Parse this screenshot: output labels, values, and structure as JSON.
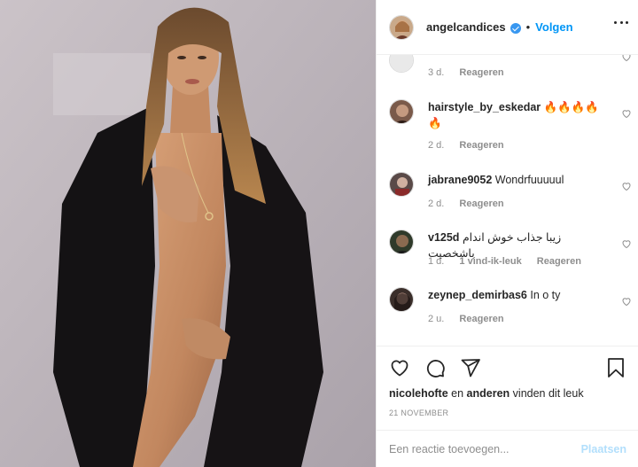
{
  "header": {
    "username": "angelcandices",
    "separator": "•",
    "follow_label": "Volgen"
  },
  "comments": [
    {
      "user": "",
      "text": "",
      "time": "3 d.",
      "likes": "",
      "reply_label": "Reageren"
    },
    {
      "user": "hairstyle_by_eskedar",
      "text": "🔥🔥🔥🔥🔥",
      "time": "2 d.",
      "likes": "",
      "reply_label": "Reageren"
    },
    {
      "user": "jabrane9052",
      "text": "Wondrfuuuuul",
      "time": "2 d.",
      "likes": "",
      "reply_label": "Reageren"
    },
    {
      "user": "v125d",
      "text": "زیبا جذاب خوش اندام باشخصیت",
      "time": "1 d.",
      "likes": "1 vind-ik-leuk",
      "reply_label": "Reageren"
    },
    {
      "user": "zeynep_demirbas6",
      "text": "In o ty",
      "time": "2 u.",
      "likes": "",
      "reply_label": "Reageren"
    }
  ],
  "likes": {
    "user1": "nicolehofte",
    "connector": "en",
    "user2": "anderen",
    "suffix": "vinden dit leuk"
  },
  "date": "21 NOVEMBER",
  "add_comment": {
    "placeholder": "Een reactie toevoegen...",
    "post_label": "Plaatsen"
  },
  "colors": {
    "accent": "#0095f6",
    "verified": "#3897f0",
    "muted": "#8e8e8e",
    "post_disabled": "#b2dffc"
  },
  "icons": [
    "heart-icon",
    "comment-icon",
    "share-icon",
    "bookmark-icon",
    "more-icon",
    "verified-badge"
  ]
}
